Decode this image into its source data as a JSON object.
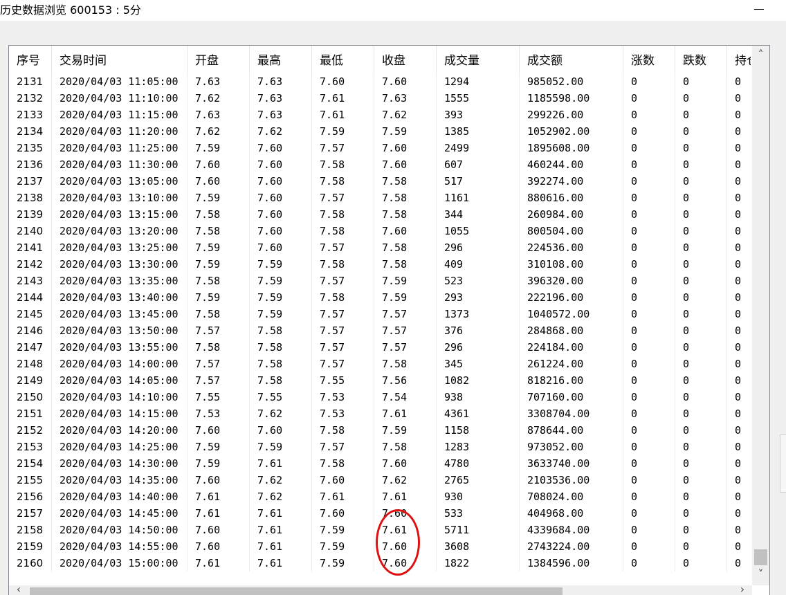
{
  "window": {
    "title": "历史数据浏览 600153 : 5分",
    "minimize_label": "─"
  },
  "table": {
    "columns": [
      "序号",
      "交易时间",
      "开盘",
      "最高",
      "最低",
      "收盘",
      "成交量",
      "成交额",
      "涨数",
      "跌数",
      "持仓"
    ],
    "rows": [
      [
        "2131",
        "2020/04/03 11:05:00",
        "7.63",
        "7.63",
        "7.60",
        "7.60",
        "1294",
        "985052.00",
        "0",
        "0",
        "0"
      ],
      [
        "2132",
        "2020/04/03 11:10:00",
        "7.62",
        "7.63",
        "7.61",
        "7.63",
        "1555",
        "1185598.00",
        "0",
        "0",
        "0"
      ],
      [
        "2133",
        "2020/04/03 11:15:00",
        "7.63",
        "7.63",
        "7.61",
        "7.62",
        "393",
        "299226.00",
        "0",
        "0",
        "0"
      ],
      [
        "2134",
        "2020/04/03 11:20:00",
        "7.62",
        "7.62",
        "7.59",
        "7.59",
        "1385",
        "1052902.00",
        "0",
        "0",
        "0"
      ],
      [
        "2135",
        "2020/04/03 11:25:00",
        "7.59",
        "7.60",
        "7.57",
        "7.60",
        "2499",
        "1895608.00",
        "0",
        "0",
        "0"
      ],
      [
        "2136",
        "2020/04/03 11:30:00",
        "7.60",
        "7.60",
        "7.58",
        "7.60",
        "607",
        "460244.00",
        "0",
        "0",
        "0"
      ],
      [
        "2137",
        "2020/04/03 13:05:00",
        "7.60",
        "7.60",
        "7.58",
        "7.58",
        "517",
        "392274.00",
        "0",
        "0",
        "0"
      ],
      [
        "2138",
        "2020/04/03 13:10:00",
        "7.59",
        "7.60",
        "7.57",
        "7.58",
        "1161",
        "880616.00",
        "0",
        "0",
        "0"
      ],
      [
        "2139",
        "2020/04/03 13:15:00",
        "7.58",
        "7.60",
        "7.58",
        "7.58",
        "344",
        "260984.00",
        "0",
        "0",
        "0"
      ],
      [
        "2140",
        "2020/04/03 13:20:00",
        "7.58",
        "7.60",
        "7.58",
        "7.60",
        "1055",
        "800504.00",
        "0",
        "0",
        "0"
      ],
      [
        "2141",
        "2020/04/03 13:25:00",
        "7.59",
        "7.60",
        "7.57",
        "7.58",
        "296",
        "224536.00",
        "0",
        "0",
        "0"
      ],
      [
        "2142",
        "2020/04/03 13:30:00",
        "7.59",
        "7.59",
        "7.58",
        "7.58",
        "409",
        "310108.00",
        "0",
        "0",
        "0"
      ],
      [
        "2143",
        "2020/04/03 13:35:00",
        "7.58",
        "7.59",
        "7.57",
        "7.59",
        "523",
        "396320.00",
        "0",
        "0",
        "0"
      ],
      [
        "2144",
        "2020/04/03 13:40:00",
        "7.59",
        "7.59",
        "7.58",
        "7.59",
        "293",
        "222196.00",
        "0",
        "0",
        "0"
      ],
      [
        "2145",
        "2020/04/03 13:45:00",
        "7.58",
        "7.59",
        "7.57",
        "7.57",
        "1373",
        "1040572.00",
        "0",
        "0",
        "0"
      ],
      [
        "2146",
        "2020/04/03 13:50:00",
        "7.57",
        "7.58",
        "7.57",
        "7.57",
        "376",
        "284868.00",
        "0",
        "0",
        "0"
      ],
      [
        "2147",
        "2020/04/03 13:55:00",
        "7.58",
        "7.58",
        "7.57",
        "7.57",
        "296",
        "224184.00",
        "0",
        "0",
        "0"
      ],
      [
        "2148",
        "2020/04/03 14:00:00",
        "7.57",
        "7.58",
        "7.57",
        "7.58",
        "345",
        "261224.00",
        "0",
        "0",
        "0"
      ],
      [
        "2149",
        "2020/04/03 14:05:00",
        "7.57",
        "7.58",
        "7.55",
        "7.56",
        "1082",
        "818216.00",
        "0",
        "0",
        "0"
      ],
      [
        "2150",
        "2020/04/03 14:10:00",
        "7.55",
        "7.55",
        "7.53",
        "7.54",
        "938",
        "707160.00",
        "0",
        "0",
        "0"
      ],
      [
        "2151",
        "2020/04/03 14:15:00",
        "7.53",
        "7.62",
        "7.53",
        "7.61",
        "4361",
        "3308704.00",
        "0",
        "0",
        "0"
      ],
      [
        "2152",
        "2020/04/03 14:20:00",
        "7.60",
        "7.60",
        "7.58",
        "7.59",
        "1158",
        "878644.00",
        "0",
        "0",
        "0"
      ],
      [
        "2153",
        "2020/04/03 14:25:00",
        "7.59",
        "7.59",
        "7.57",
        "7.58",
        "1283",
        "973052.00",
        "0",
        "0",
        "0"
      ],
      [
        "2154",
        "2020/04/03 14:30:00",
        "7.59",
        "7.61",
        "7.58",
        "7.60",
        "4780",
        "3633740.00",
        "0",
        "0",
        "0"
      ],
      [
        "2155",
        "2020/04/03 14:35:00",
        "7.60",
        "7.62",
        "7.60",
        "7.62",
        "2765",
        "2103536.00",
        "0",
        "0",
        "0"
      ],
      [
        "2156",
        "2020/04/03 14:40:00",
        "7.61",
        "7.62",
        "7.61",
        "7.61",
        "930",
        "708024.00",
        "0",
        "0",
        "0"
      ],
      [
        "2157",
        "2020/04/03 14:45:00",
        "7.61",
        "7.61",
        "7.60",
        "7.60",
        "533",
        "404968.00",
        "0",
        "0",
        "0"
      ],
      [
        "2158",
        "2020/04/03 14:50:00",
        "7.60",
        "7.61",
        "7.59",
        "7.61",
        "5711",
        "4339684.00",
        "0",
        "0",
        "0"
      ],
      [
        "2159",
        "2020/04/03 14:55:00",
        "7.60",
        "7.61",
        "7.59",
        "7.60",
        "3608",
        "2743224.00",
        "0",
        "0",
        "0"
      ],
      [
        "2160",
        "2020/04/03 15:00:00",
        "7.61",
        "7.61",
        "7.59",
        "7.60",
        "1822",
        "1384596.00",
        "0",
        "0",
        "0"
      ]
    ]
  },
  "scrollbars": {
    "up_icon": "˄",
    "down_icon": "˅",
    "left_icon": "‹",
    "right_icon": "›"
  },
  "colors": {
    "annotation": "#e01010",
    "scroll_thumb": "#c1c1c1",
    "client_bg": "#f0f0f0"
  }
}
